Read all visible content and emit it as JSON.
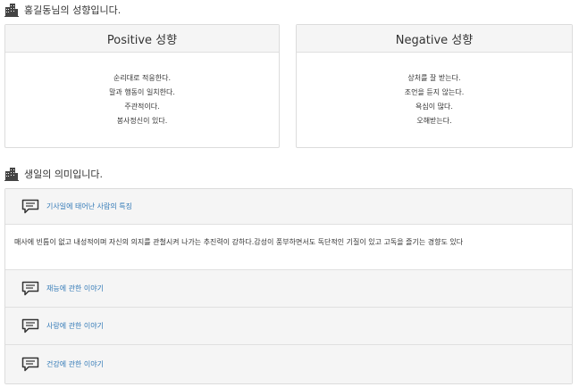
{
  "personality": {
    "title": "홍길동님의 성향입니다.",
    "icon": "building-icon",
    "positive": {
      "header": "Positive 성향",
      "items": [
        "순리대로 적응한다.",
        "말과 행동이 일치한다.",
        "주관적이다.",
        "봉사정신이 있다."
      ]
    },
    "negative": {
      "header": "Negative 성향",
      "items": [
        "상처를 잘 받는다.",
        "조언을 듣지 않는다.",
        "욕심이 많다.",
        "오해받는다."
      ]
    }
  },
  "meaning": {
    "title": "생일의 의미입니다.",
    "icon": "building-icon",
    "rows": [
      {
        "label": "기사일에 태어난 사람의 특징",
        "icon": "chat-icon"
      },
      {
        "label": "재능에 관한 이야기",
        "icon": "chat-icon"
      },
      {
        "label": "사랑에 관한 이야기",
        "icon": "chat-icon"
      },
      {
        "label": "건강에 관한 이야기",
        "icon": "chat-icon"
      }
    ],
    "description": "매사에 빈틈이 없고 내성적이며 자신의 의지를 관철시켜 나가는 추진력이 강하다.감성이 풍부하면서도 독단적인 기질이 있고 고독을 즐기는 경향도 있다"
  },
  "colors": {
    "link": "#337ab7",
    "panel_header_bg": "#f5f5f5",
    "border": "#dcdcdc"
  }
}
